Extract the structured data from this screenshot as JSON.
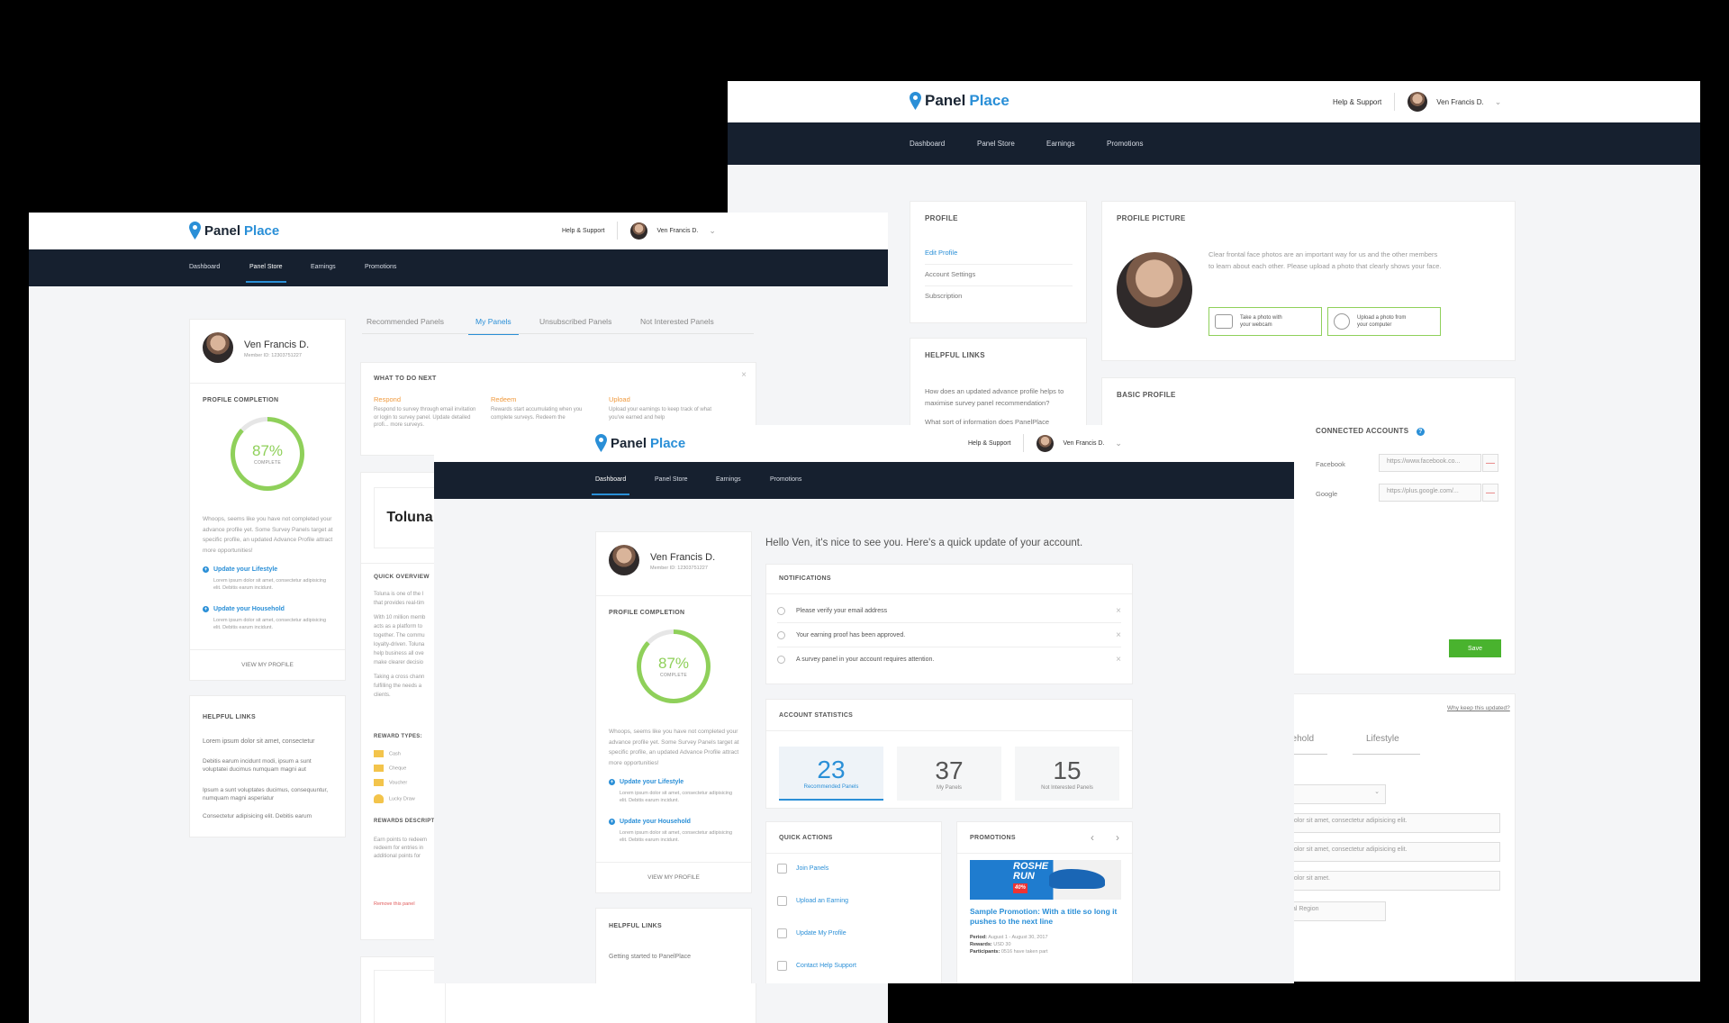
{
  "brand": {
    "panel": "Panel",
    "place": "Place"
  },
  "header": {
    "help": "Help & Support",
    "user": "Ven Francis D."
  },
  "nav": [
    "Dashboard",
    "Panel Store",
    "Earnings",
    "Promotions"
  ],
  "profile_card": {
    "name": "Ven Francis D.",
    "member_id": "Member ID: 12303751227",
    "completion_title": "PROFILE COMPLETION",
    "percent": "87%",
    "complete": "COMPLETE",
    "completion_value": 0.87,
    "message": "Whoops, seems like you have not completed your advance profile yet. Some Survey Panels target at specific profile, an updated Advance Profile attract more opportunities!",
    "links": [
      {
        "label": "Update your Lifestyle",
        "desc": "Lorem ipsum dolor sit amet, consectetur adipisicing elit. Debitis earum incidunt."
      },
      {
        "label": "Update your Household",
        "desc": "Lorem ipsum dolor sit amet, consectetur adipisicing elit. Debitis earum incidunt."
      }
    ],
    "view_profile": "VIEW MY PROFILE"
  },
  "back": {
    "profile_menu_title": "PROFILE",
    "profile_menu": [
      "Edit Profile",
      "Account Settings",
      "Subscription"
    ],
    "helpful_title": "HELPFUL LINKS",
    "helpful_q1": "How does an updated advance profile helps to maximise survey panel recommendation?",
    "helpful_q2": "What sort of information does PanelPlace",
    "pp_title": "PROFILE PICTURE",
    "pp_desc": "Clear frontal face photos are an important way for us and the other members to learn about each other. Please upload a photo that clearly shows your face.",
    "webcam": [
      "Take a photo with",
      "your webcam"
    ],
    "upload": [
      "Upload a photo from",
      "your computer"
    ],
    "basic_title": "BASIC PROFILE",
    "connected": "CONNECTED ACCOUNTS",
    "fb_label": "Facebook",
    "fb_value": "https://www.facebook.co...",
    "g_label": "Google",
    "g_value": "https://plus.google.com/...",
    "save": "Save",
    "why": "Why keep this updated?",
    "tab_household": "usehold",
    "tab_lifestyle": "Lifestyle",
    "lorem1": "dolor sit amet, consectetur adipisicing elit.",
    "lorem2": "dolor sit amet, consectetur adipisicing elit.",
    "lorem3": "dolor sit amet.",
    "region": "tal Region"
  },
  "middle": {
    "tabs": [
      "Recommended Panels",
      "My Panels",
      "Unsubscribed Panels",
      "Not Interested Panels"
    ],
    "what_next": "WHAT TO DO NEXT",
    "steps": [
      {
        "t": "Respond",
        "d": "Respond to survey through email invitation or login to survey panel. Update detailed profi... more surveys."
      },
      {
        "t": "Redeem",
        "d": "Rewards start accumulating when you complete surveys. Redeem the"
      },
      {
        "t": "Upload",
        "d": "Upload your earnings to keep track of what you've earned and help"
      }
    ],
    "toluna": "Toluna",
    "quick": "QUICK OVERVIEW",
    "q_text": [
      "Toluna is one of the l",
      "that provides real-tim",
      "With 10 million memb",
      "acts as a platform to",
      "together. The commu",
      "loyalty-driven. Toluna",
      "help business all ove",
      "make clearer decisio",
      "Taking a cross chann",
      "fulfilling the needs a",
      "clients."
    ],
    "reward_types": "REWARD TYPES:",
    "rewards": [
      "Cash",
      "Cheque",
      "Voucher",
      "Lucky Draw"
    ],
    "rewards_desc": "REWARDS DESCRIPT",
    "rd_text": [
      "Earn points to redeem",
      "redeem for entries in",
      "additional points for"
    ],
    "remove": "Remove this panel",
    "helpful_title": "HELPFUL LINKS",
    "helpful": [
      "Lorem ipsum dolor sit amet, consectetur",
      "Debitis earum incidunt modi, ipsum a sunt voluptatei ducimus numquam magni aut",
      "Ipsum a sunt voluptates ducimus, consequuntur, numquam magni asperiatur",
      "Consectetur adipisicing elit. Debitis earum"
    ]
  },
  "front": {
    "greeting": "Hello Ven, it's nice to see you. Here's a quick update of your account.",
    "notif_title": "NOTIFICATIONS",
    "notifs": [
      "Please verify your email address",
      "Your earning proof has been approved.",
      "A survey panel in your account requires attention."
    ],
    "stats_title": "ACCOUNT STATISTICS",
    "stats": [
      {
        "n": "23",
        "c": "Recommended Panels"
      },
      {
        "n": "37",
        "c": "My Panels"
      },
      {
        "n": "15",
        "c": "Not Interested Panels"
      }
    ],
    "qa_title": "QUICK ACTIONS",
    "qa": [
      "Join Panels",
      "Upload an Earning",
      "Update My Profile",
      "Contact Help Support"
    ],
    "promo_title": "PROMOTIONS",
    "promo_heading": "Sample Promotion: With a title so long it pushes to the next line",
    "promo_banner": [
      "ROSHE",
      "RUN",
      "40%"
    ],
    "promo_period": "Period:",
    "promo_period_v": "August 1 - August 30, 2017",
    "promo_rewards": "Rewards:",
    "promo_rewards_v": "USD 30",
    "promo_part": "Participants:",
    "promo_part_v": "0516 have taken part",
    "helpful_title": "HELPFUL LINKS",
    "helpful1": "Getting started to PanelPlace"
  }
}
